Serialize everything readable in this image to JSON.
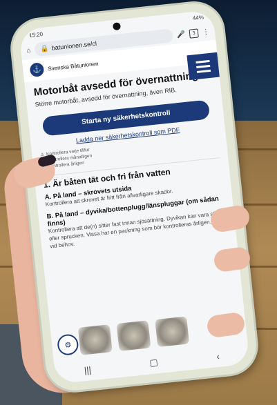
{
  "status": {
    "time": "15:20",
    "icons_right": "44%"
  },
  "browser": {
    "url": "batunionen.se/cl",
    "tab_count": "3"
  },
  "site": {
    "brand": "Svenska Båtunionen"
  },
  "page": {
    "title": "Motorbåt avsedd för övernattning",
    "subtitle": "Större motorbåt, avsedd för övernattning, även RIB.",
    "start_button": "Starta ny säkerhetskontroll",
    "download_link": "Ladda ner säkerhetskontroll som PDF",
    "legend": [
      "Kontrollera varje tillfur",
      "Kontrollera månatligen",
      "Kontrollera årligen"
    ],
    "section_title": "1. Är båten tät och fri från vatten",
    "items": [
      {
        "title": "A. På land – skrovets utsida",
        "text": "Kontrollera att skrovet är fritt från allvarligare skador."
      },
      {
        "title": "B. På land – dyvika/bottenplugg/länspluggar (om sådan finns)",
        "text": "Kontrollera att de(n) sitter fast innan sjösättning. Dyvikan kan vara sliten eller sprucken. Vissa har en packning som bör kontrolleras årligen. Byts vid behov."
      }
    ]
  },
  "icons": {
    "home": "home-icon",
    "lock": "lock-icon",
    "mic": "mic-icon",
    "more": "more-icon",
    "menu": "menu-icon"
  },
  "colors": {
    "brand": "#1c3a7a",
    "accent": "#f2c230"
  }
}
